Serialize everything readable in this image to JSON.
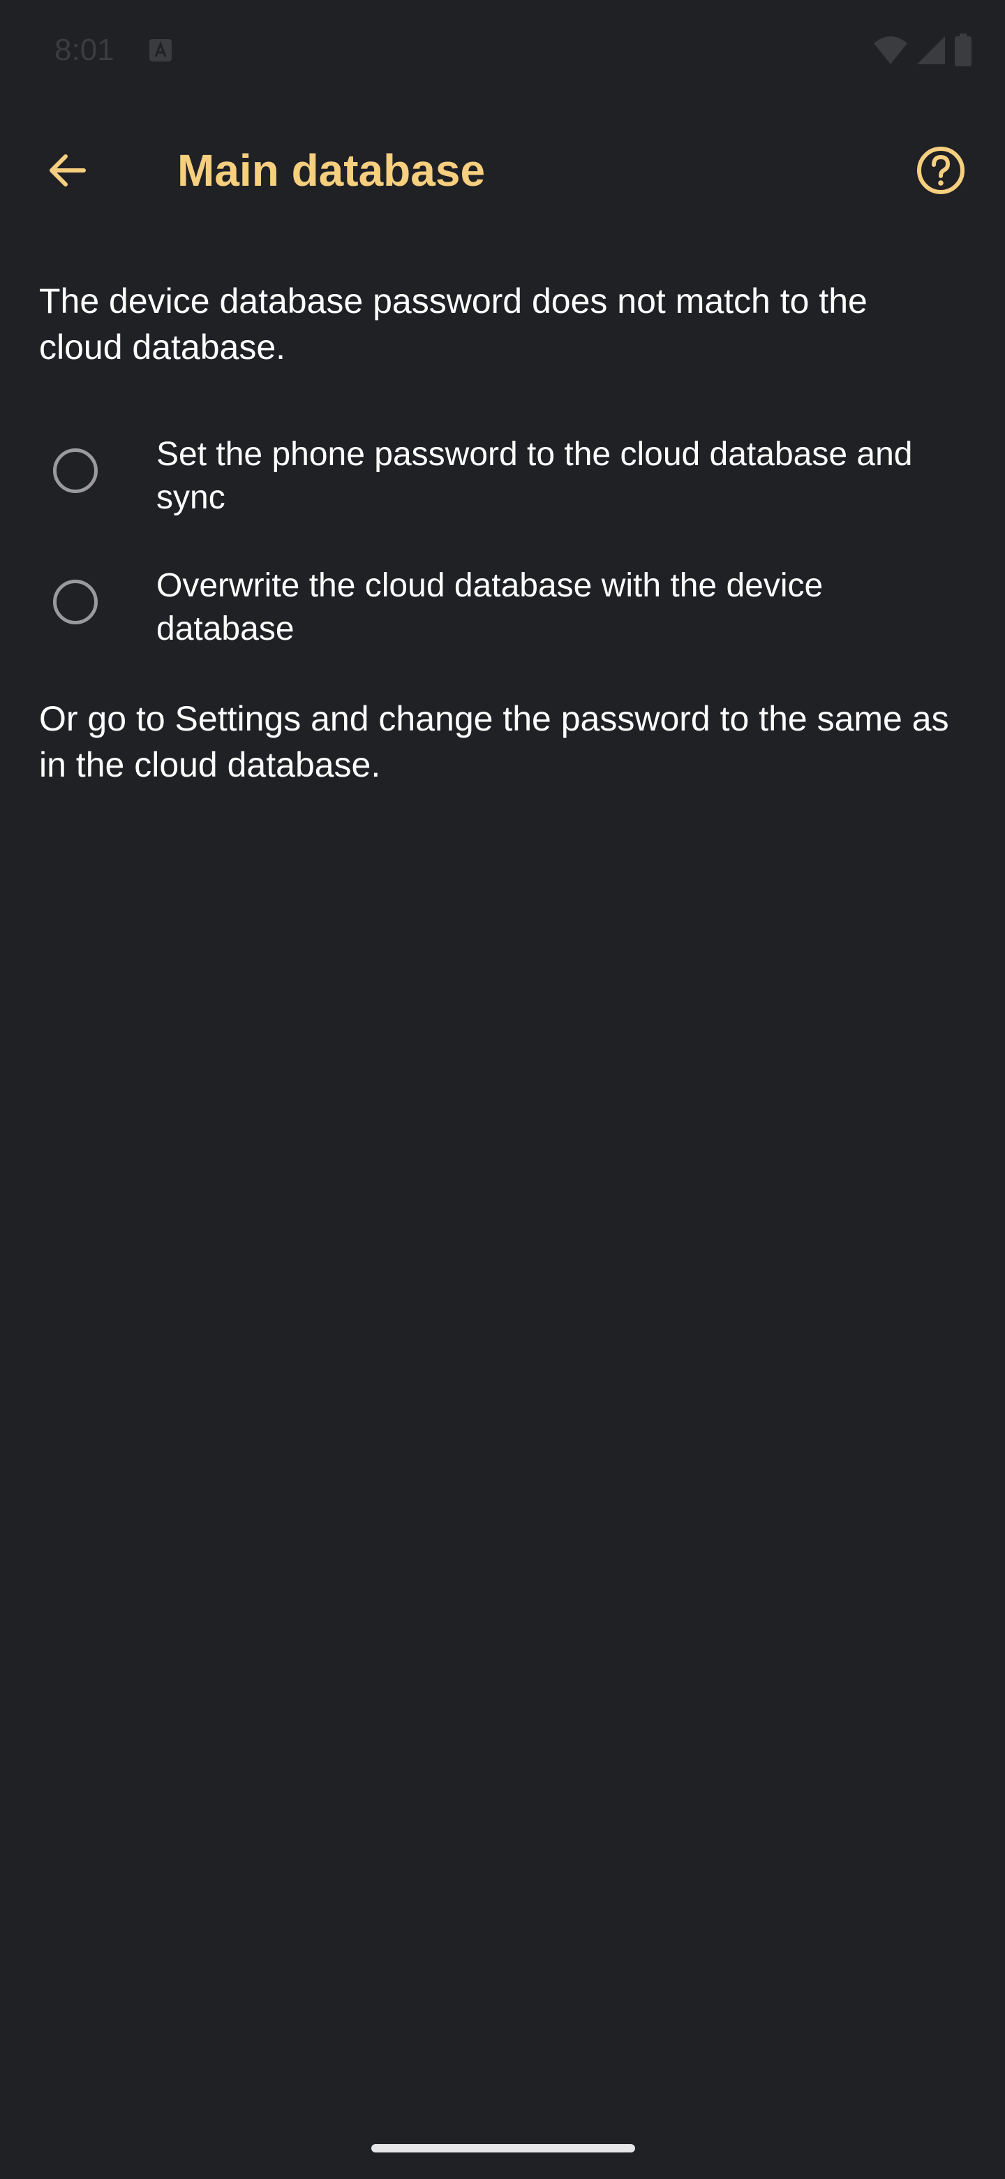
{
  "status_bar": {
    "time": "8:01",
    "icons": [
      "notification-a-icon",
      "wifi-icon",
      "signal-icon",
      "battery-icon"
    ]
  },
  "app_bar": {
    "title": "Main database",
    "back_icon": "arrow-left-icon",
    "help_icon": "help-circle-icon",
    "accent_color": "#f6cf7f"
  },
  "main": {
    "message": "The device database password does not match to the cloud database.",
    "options": [
      {
        "label": "Set the phone password to the cloud database and sync",
        "selected": false
      },
      {
        "label": "Overwrite the cloud database with the device database",
        "selected": false
      }
    ],
    "footer_note": "Or go to Settings and change the password to the same as in the cloud database."
  },
  "colors": {
    "background": "#202125",
    "text": "#ffffff",
    "radio_border": "#9a9a9d"
  }
}
